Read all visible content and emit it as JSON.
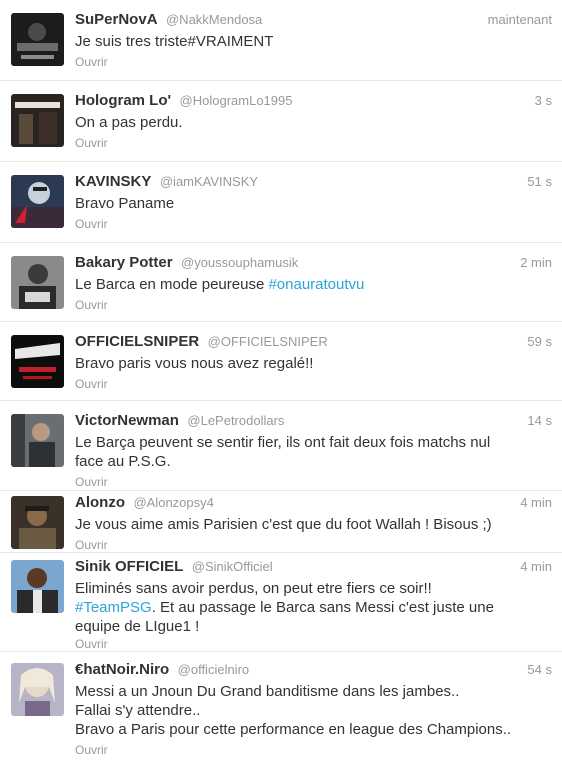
{
  "tweets": [
    {
      "name": "SuPerNovA",
      "handle": "@NakkMendosa",
      "time": "maintenant",
      "text": "Je suis tres triste#VRAIMENT",
      "hashtag": "",
      "text_after": "",
      "open": "Ouvrir"
    },
    {
      "name": "Hologram Lo'",
      "handle": "@HologramLo1995",
      "time": "3 s",
      "text": "On a pas perdu.",
      "hashtag": "",
      "text_after": "",
      "open": "Ouvrir"
    },
    {
      "name": "KAVINSKY",
      "handle": "@iamKAVINSKY",
      "time": "51 s",
      "text": "Bravo Paname",
      "hashtag": "",
      "text_after": "",
      "open": "Ouvrir"
    },
    {
      "name": "Bakary Potter",
      "handle": "@youssouphamusik",
      "time": "2 min",
      "text": "Le Barca en mode peureuse ",
      "hashtag": "#onauratoutvu",
      "text_after": "",
      "open": "Ouvrir"
    },
    {
      "name": "OFFICIELSNIPER",
      "handle": "@OFFICIELSNIPER",
      "time": "59 s",
      "text": "Bravo paris vous nous avez regalé!!",
      "hashtag": "",
      "text_after": "",
      "open": "Ouvrir"
    },
    {
      "name": "VictorNewman",
      "handle": "@LePetrodollars",
      "time": "14 s",
      "text": "Le Barça peuvent se sentir fier, ils ont fait deux fois matchs nul\nface au P.S.G.",
      "hashtag": "",
      "text_after": "",
      "open": "Ouvrir"
    },
    {
      "name": "Alonzo",
      "handle": "@Alonzopsy4",
      "time": "4 min",
      "text": "Je vous aime amis Parisien c'est que du foot Wallah ! Bisous ;)",
      "hashtag": "",
      "text_after": "",
      "open": "Ouvrir"
    },
    {
      "name": "Sinik OFFICIEL",
      "handle": "@SinikOfficiel",
      "time": "4 min",
      "text": "Eliminés sans avoir perdus, on peut etre fiers ce soir!!\n",
      "hashtag": "#TeamPSG",
      "text_after": ". Et au passage le Barca sans Messi c'est juste une\nequipe de LIgue1 !",
      "open": "Ouvrir"
    },
    {
      "name": "€hatNoir.Niro",
      "handle": "@officielniro",
      "time": "54 s",
      "text": "Messi a un Jnoun Du Grand banditisme dans les jambes..\nFallai s'y attendre..\nBravo a Paris pour cette performance en league des Champions..",
      "hashtag": "",
      "text_after": "",
      "open": "Ouvrir"
    }
  ]
}
